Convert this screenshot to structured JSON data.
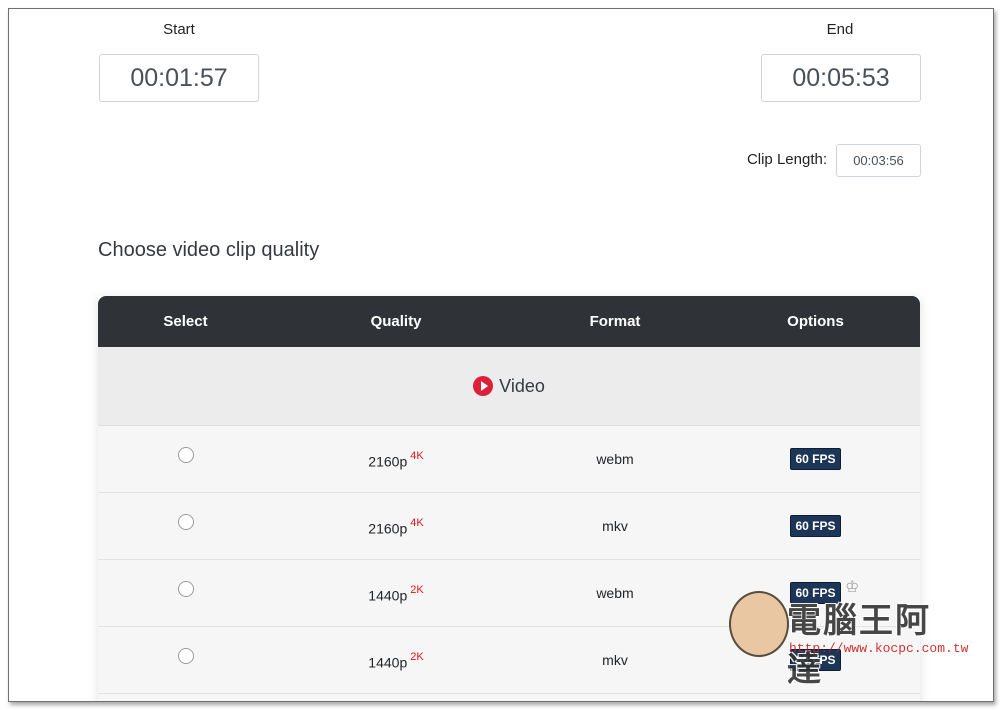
{
  "trim": {
    "start_label": "Start",
    "start_value": "00:01:57",
    "end_label": "End",
    "end_value": "00:05:53",
    "clip_length_label": "Clip Length:",
    "clip_length_value": "00:03:56"
  },
  "section_title": "Choose video clip quality",
  "table": {
    "headers": [
      "Select",
      "Quality",
      "Format",
      "Options"
    ],
    "group_label": "Video",
    "rows": [
      {
        "quality": "2160p",
        "tag": "4K",
        "format": "webm",
        "option": "60 FPS"
      },
      {
        "quality": "2160p",
        "tag": "4K",
        "format": "mkv",
        "option": "60 FPS"
      },
      {
        "quality": "1440p",
        "tag": "2K",
        "format": "webm",
        "option": "60 FPS"
      },
      {
        "quality": "1440p",
        "tag": "2K",
        "format": "mkv",
        "option": "60 FPS"
      }
    ]
  },
  "watermark": {
    "title": "電腦王阿達",
    "url": "http://www.kocpc.com.tw"
  },
  "colors": {
    "header_bg": "#2f3338",
    "badge_bg": "#1d3557",
    "tag_red": "#e0161c",
    "play_red": "#dc1f3a"
  }
}
